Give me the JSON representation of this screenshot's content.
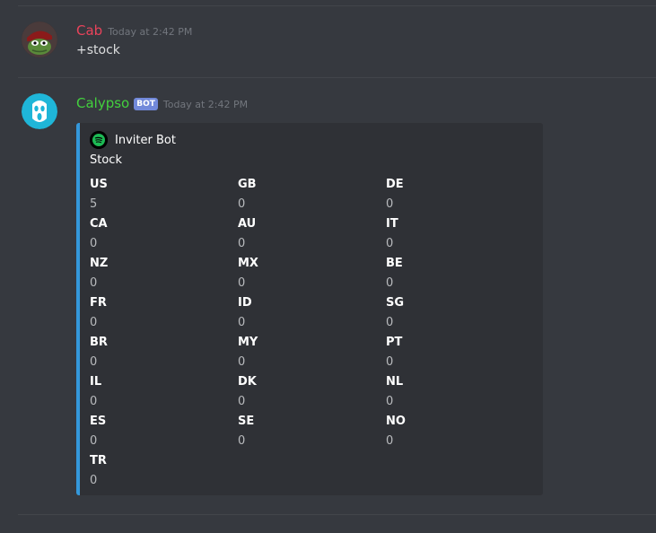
{
  "messages": [
    {
      "username": "Cab",
      "username_color": "#e9435b",
      "timestamp": "Today at 2:42 PM",
      "content": "+stock",
      "avatar_icon": "pepe-avatar-icon"
    },
    {
      "username": "Calypso",
      "username_color": "#43d13e",
      "bot_tag": "BOT",
      "timestamp": "Today at 2:42 PM",
      "avatar_icon": "ghost-face-avatar-icon",
      "embed": {
        "accent_color": "#3498db",
        "author_name": "Inviter Bot",
        "author_icon": "spotify-icon",
        "title": "Stock",
        "fields": [
          {
            "name": "US",
            "value": "5"
          },
          {
            "name": "GB",
            "value": "0"
          },
          {
            "name": "DE",
            "value": "0"
          },
          {
            "name": "CA",
            "value": "0"
          },
          {
            "name": "AU",
            "value": "0"
          },
          {
            "name": "IT",
            "value": "0"
          },
          {
            "name": "NZ",
            "value": "0"
          },
          {
            "name": "MX",
            "value": "0"
          },
          {
            "name": "BE",
            "value": "0"
          },
          {
            "name": "FR",
            "value": "0"
          },
          {
            "name": "ID",
            "value": "0"
          },
          {
            "name": "SG",
            "value": "0"
          },
          {
            "name": "BR",
            "value": "0"
          },
          {
            "name": "MY",
            "value": "0"
          },
          {
            "name": "PT",
            "value": "0"
          },
          {
            "name": "IL",
            "value": "0"
          },
          {
            "name": "DK",
            "value": "0"
          },
          {
            "name": "NL",
            "value": "0"
          },
          {
            "name": "ES",
            "value": "0"
          },
          {
            "name": "SE",
            "value": "0"
          },
          {
            "name": "NO",
            "value": "0"
          },
          {
            "name": "TR",
            "value": "0"
          }
        ]
      }
    }
  ]
}
